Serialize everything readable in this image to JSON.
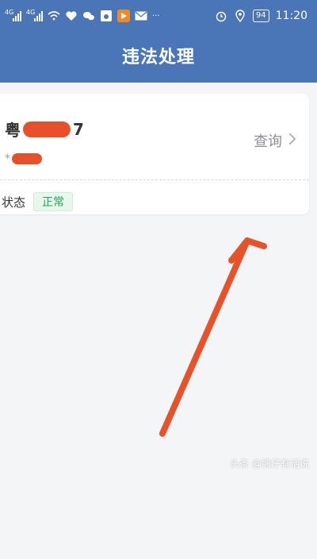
{
  "status_bar": {
    "network_left": "4G",
    "network_right": "4G",
    "battery": "94",
    "time": "11:20",
    "icons": [
      "wifi-icon",
      "health-icon",
      "wechat-icon",
      "baidu-icon",
      "video-app-icon",
      "mail-icon",
      "more-icon",
      "alarm-icon",
      "location-icon",
      "battery-icon"
    ]
  },
  "header": {
    "title": "违法处理"
  },
  "vehicle_card": {
    "plate_prefix": "粤",
    "plate_suffix": "7",
    "sub_prefix": "*",
    "query_label": "查询",
    "status_label": "状态",
    "status_value": "正常"
  },
  "colors": {
    "header_bg": "#4a76b8",
    "redaction": "#e8502b",
    "arrow": "#e6532a",
    "badge_bg": "#e7f7ec",
    "badge_text": "#22a65b"
  },
  "watermark": "头条 @熊仔有话说"
}
